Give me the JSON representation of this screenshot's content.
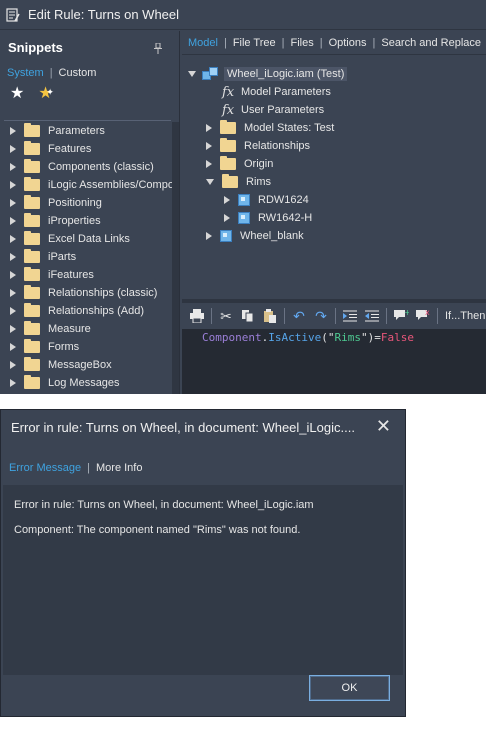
{
  "edit_window": {
    "title": "Edit Rule: Turns on Wheel"
  },
  "snippets": {
    "header": "Snippets",
    "tabs": [
      "System",
      "Custom"
    ],
    "items": [
      "Parameters",
      "Features",
      "Components (classic)",
      "iLogic Assemblies/Components",
      "Positioning",
      "iProperties",
      "Excel Data Links",
      "iParts",
      "iFeatures",
      "Relationships (classic)",
      "Relationships (Add)",
      "Measure",
      "Forms",
      "MessageBox",
      "Log Messages"
    ]
  },
  "top_tabs": [
    "Model",
    "File Tree",
    "Files",
    "Options",
    "Search and Replace"
  ],
  "tree": {
    "root": "Wheel_iLogic.iam (Test)",
    "model_parameters": "Model Parameters",
    "user_parameters": "User Parameters",
    "model_states": "Model States: Test",
    "relationships": "Relationships",
    "origin": "Origin",
    "rims": "Rims",
    "rim1": "RDW1624",
    "rim2": "RW1642-H",
    "wheel_blank": "Wheel_blank"
  },
  "toolbar": {
    "if_text": "If...Then"
  },
  "code": {
    "object": "Component",
    "dot": ".",
    "member": "IsActive",
    "paren_open": "(",
    "quote1": "\"",
    "string_value": "Rims",
    "quote2": "\"",
    "paren_close": ")",
    "equals": "=",
    "keyword": "False"
  },
  "error_dialog": {
    "title": "Error in rule: Turns on Wheel, in document: Wheel_iLogic....",
    "tabs": [
      "Error Message",
      "More Info"
    ],
    "line1": "Error in rule: Turns on Wheel, in document: Wheel_iLogic.iam",
    "line2": "Component: The component named \"Rims\" was not found.",
    "ok_label": "OK"
  },
  "icons": {
    "app": "edit-rule-icon",
    "pin": "pin-icon",
    "close": "close-icon"
  },
  "colors": {
    "accent": "#3fa3e0",
    "panel": "#3b4453",
    "folder": "#f1d592"
  }
}
